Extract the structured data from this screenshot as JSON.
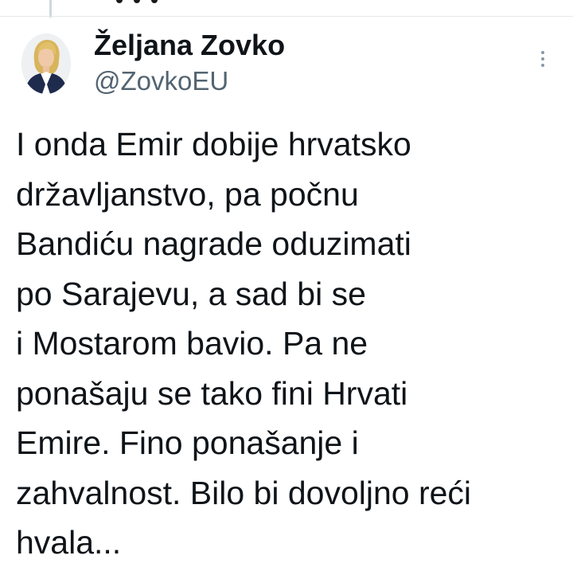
{
  "tweet": {
    "author": {
      "name": "Željana Zovko",
      "handle": "@ZovkoEU"
    },
    "text_lines": [
      "I onda Emir dobije hrvatsko",
      "državljanstvo, pa počnu",
      "Bandiću nagrade oduzimati",
      "po Sarajevu, a sad bi se",
      "i Mostarom bavio. Pa ne",
      "ponašaju se tako fini Hrvati",
      "Emire. Fino ponašanje i",
      "zahvalnost. Bilo bi dovoljno reći",
      "hvala..."
    ]
  },
  "icons": {
    "more": "more-vertical-icon",
    "avatar": "profile-photo"
  },
  "colors": {
    "text_primary": "#0f1419",
    "text_secondary": "#536471",
    "divider": "#e6e8ea",
    "thread_line": "#cfd9de"
  }
}
